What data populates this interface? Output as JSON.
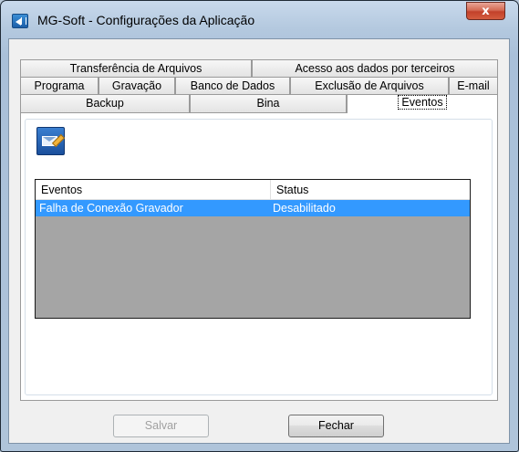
{
  "window": {
    "title": "MG-Soft - Configurações da Aplicação",
    "close_label": "x"
  },
  "tabs": {
    "row1": [
      "Transferência de Arquivos",
      "Acesso aos dados por terceiros"
    ],
    "row2": [
      "Programa",
      "Gravação",
      "Banco de Dados",
      "Exclusão de Arquivos",
      "E-mail"
    ],
    "row3": [
      "Backup",
      "Bina",
      "Eventos"
    ],
    "active": "Eventos"
  },
  "toolbar": {
    "icon": "mail-edit-icon"
  },
  "events_list": {
    "columns": [
      "Eventos",
      "Status"
    ],
    "rows": [
      {
        "evento": "Falha de Conexão Gravador",
        "status": "Desabilitado",
        "selected": true
      }
    ]
  },
  "buttons": {
    "save_label": "Salvar",
    "save_enabled": false,
    "close_label": "Fechar"
  },
  "colors": {
    "selection": "#3399ff",
    "list_background": "#a5a5a5",
    "close_button": "#c2412a"
  }
}
